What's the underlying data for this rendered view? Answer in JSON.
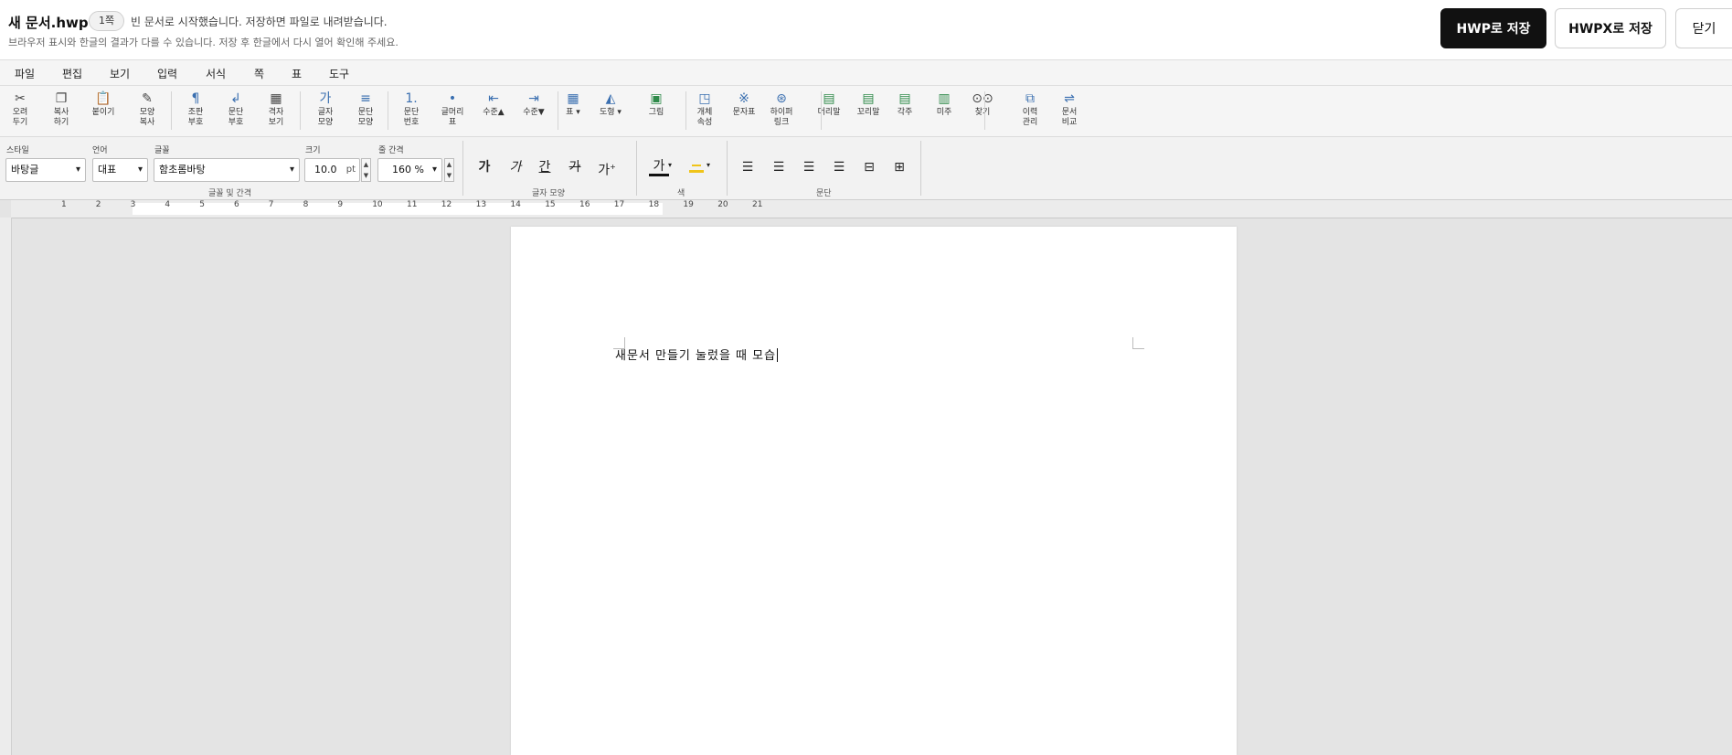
{
  "header": {
    "title": "새 문서.hwp",
    "page_badge": "1쪽",
    "status": "빈 문서로 시작했습니다. 저장하면 파일로 내려받습니다.",
    "subtitle": "브라우저 표시와 한글의 결과가 다를 수 있습니다. 저장 후 한글에서 다시 열어 확인해 주세요.",
    "save_hwp": "HWP로 저장",
    "save_hwpx": "HWPX로 저장",
    "close": "닫기"
  },
  "menu": [
    "파일",
    "편집",
    "보기",
    "입력",
    "서식",
    "쪽",
    "표",
    "도구"
  ],
  "toolbar": [
    {
      "name": "cut",
      "label": "오려\n두기",
      "icon": "scissors-icon",
      "glyph": "✂"
    },
    {
      "name": "copy",
      "label": "복사\n하기",
      "icon": "copy-icon",
      "glyph": "❐"
    },
    {
      "name": "paste",
      "label": "붙이기",
      "icon": "paste-icon",
      "glyph": "📋"
    },
    {
      "name": "format-copy",
      "label": "모양\n복사",
      "icon": "brush-icon",
      "glyph": "✎"
    },
    {
      "name": "control-marks",
      "label": "조판\n부호",
      "icon": "pilcrow-icon",
      "glyph": "¶"
    },
    {
      "name": "para-marks",
      "label": "문단\n부호",
      "icon": "return-icon",
      "glyph": "↲"
    },
    {
      "name": "grid-view",
      "label": "격자\n보기",
      "icon": "grid-icon",
      "glyph": "▦"
    },
    {
      "name": "char-shape",
      "label": "글자\n모양",
      "icon": "char-shape-icon",
      "glyph": "가"
    },
    {
      "name": "para-shape",
      "label": "문단\n모양",
      "icon": "para-shape-icon",
      "glyph": "≡"
    },
    {
      "name": "para-number",
      "label": "문단\n번호",
      "icon": "numbering-icon",
      "glyph": "1."
    },
    {
      "name": "bullet",
      "label": "글머리\n표",
      "icon": "bullet-icon",
      "glyph": "•"
    },
    {
      "name": "level-up",
      "label": "수준▲",
      "icon": "outdent-icon",
      "glyph": "⇤"
    },
    {
      "name": "level-down",
      "label": "수준▼",
      "icon": "indent-icon",
      "glyph": "⇥"
    },
    {
      "name": "table",
      "label": "표 ▾",
      "icon": "table-icon",
      "glyph": "▦"
    },
    {
      "name": "shape",
      "label": "도형 ▾",
      "icon": "shape-icon",
      "glyph": "◭"
    },
    {
      "name": "picture",
      "label": "그림",
      "icon": "picture-icon",
      "glyph": "▣"
    },
    {
      "name": "object-props",
      "label": "개체\n속성",
      "icon": "object-icon",
      "glyph": "◳"
    },
    {
      "name": "symbols",
      "label": "문자표",
      "icon": "symbol-icon",
      "glyph": "※"
    },
    {
      "name": "hyperlink",
      "label": "하이퍼\n링크",
      "icon": "link-icon",
      "glyph": "⊛"
    },
    {
      "name": "header",
      "label": "머리말",
      "icon": "header-icon",
      "glyph": "▤"
    },
    {
      "name": "footer",
      "label": "꼬리말",
      "icon": "footer-icon",
      "glyph": "▤"
    },
    {
      "name": "footnote",
      "label": "각주",
      "icon": "footnote-icon",
      "glyph": "▤"
    },
    {
      "name": "endnote",
      "label": "미주",
      "icon": "endnote-icon",
      "glyph": "▥"
    },
    {
      "name": "find",
      "label": "찾기",
      "icon": "binoculars-icon",
      "glyph": "⊙⊙"
    },
    {
      "name": "history",
      "label": "이력\n관리",
      "icon": "history-icon",
      "glyph": "⧉"
    },
    {
      "name": "compare",
      "label": "문서\n비교",
      "icon": "compare-icon",
      "glyph": "⇌"
    }
  ],
  "format": {
    "style_label": "스타일",
    "style_value": "바탕글",
    "lang_label": "언어",
    "lang_value": "대표",
    "font_label": "글꼴",
    "font_value": "함초롬바탕",
    "size_label": "크기",
    "size_value": "10.0",
    "size_unit": "pt",
    "spacing_label": "줄 간격",
    "spacing_value": "160 %",
    "group_font": "글꼴 및 간격",
    "group_char": "글자 모양",
    "group_color": "색",
    "group_para": "문단",
    "bold": "가",
    "italic": "가",
    "underline": "간",
    "strike": "가",
    "superscript": "가",
    "text_color": "가",
    "colors": {
      "text": "#111111",
      "highlight": "#f0c419"
    }
  },
  "ruler": [
    "1",
    "2",
    "3",
    "4",
    "5",
    "6",
    "7",
    "8",
    "9",
    "10",
    "11",
    "12",
    "13",
    "14",
    "15",
    "16",
    "17",
    "18",
    "19",
    "20",
    "21"
  ],
  "document": {
    "text": "새문서 만들기 눌렀을 때 모습"
  }
}
